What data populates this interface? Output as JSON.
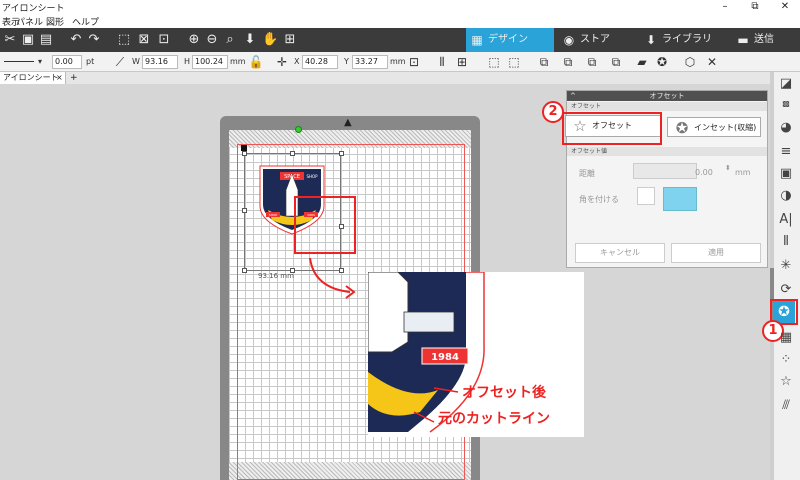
{
  "window": {
    "title": "アイロンシート",
    "minimize": "–",
    "restore": "⧉",
    "close": "✕"
  },
  "menu": [
    "表示",
    "パネル",
    "図形",
    "ヘルプ"
  ],
  "toolbar": {
    "tabs": [
      {
        "label": "デザイン",
        "icon": "grid-icon",
        "glyph": "▦"
      },
      {
        "label": "ストア",
        "icon": "store-icon",
        "glyph": "◉"
      },
      {
        "label": "ライブラリ",
        "icon": "library-icon",
        "glyph": "⬇"
      },
      {
        "label": "送信",
        "icon": "send-icon",
        "glyph": "▬"
      }
    ]
  },
  "properties": {
    "line_width": "0.00",
    "line_unit": "pt",
    "w_label": "W",
    "w_value": "93.16",
    "h_label": "H",
    "h_value": "100.24",
    "size_unit": "mm",
    "x_label": "X",
    "x_value": "40.28",
    "y_label": "Y",
    "y_value": "33.27",
    "pos_unit": "mm"
  },
  "doc_tab": {
    "label": "アイロンシート",
    "close": "×",
    "add": "+"
  },
  "canvas": {
    "sticker_top": "SPACE",
    "sticker_top2": "SHOP",
    "sticker_left": "SHOP",
    "sticker_year": "1984",
    "dimension_label": "93.16 mm",
    "zoom_year": "1984"
  },
  "callouts": {
    "offset_after": "オフセット後",
    "original_cutline": "元のカットライン"
  },
  "offset_panel": {
    "title": "オフセット",
    "section1": "オフセット",
    "offset_button": "オフセット",
    "inset_button": "インセット(収縮)",
    "section2": "オフセット値",
    "distance_label": "距離",
    "distance_value": "0.00",
    "distance_unit": "mm",
    "corner_label": "角を付ける",
    "cancel": "キャンセル",
    "apply": "適用"
  },
  "badges": {
    "one": "1",
    "two": "2"
  },
  "colors": {
    "accent": "#2aa3d8",
    "callout_red": "#e22222",
    "toolbar_dark": "#3b3b3b"
  }
}
